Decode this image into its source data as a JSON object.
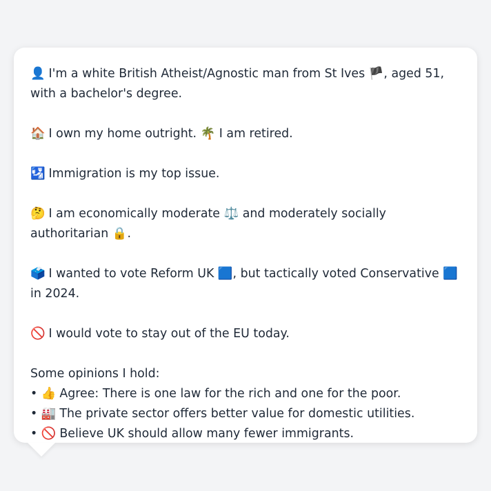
{
  "profile": {
    "identity": {
      "icon": "👤",
      "text_before_flag": " I'm a white British Atheist/Agnostic man from St Ives ",
      "flag": "🏴",
      "text_after_flag": ", aged 51, with a bachelor's degree."
    },
    "home": {
      "icon": "🏠",
      "text1": " I own my home outright. ",
      "icon2": "🌴",
      "text2": " I am retired."
    },
    "issue": {
      "icon": "🛂",
      "text": " Immigration is my top issue."
    },
    "ideology": {
      "icon": "🤔",
      "text1": " I am economically moderate ",
      "icon2": "⚖️",
      "text2": " and moderately socially authoritarian ",
      "icon3": "🔒",
      "text3": "."
    },
    "vote": {
      "icon": "🗳️",
      "text1": " I wanted to vote Reform UK ",
      "icon2": "🟦",
      "text2": ", but tactically voted Conservative ",
      "icon3": "🟦",
      "text3": " in 2024."
    },
    "eu": {
      "icon": "🚫",
      "text": " I would vote to stay out of the EU today."
    },
    "opinions": {
      "heading": "Some opinions I hold:",
      "items": [
        {
          "bullet": "•",
          "icon": "👍",
          "text": " Agree: There is one law for the rich and one for the poor."
        },
        {
          "bullet": "•",
          "icon": "🏭",
          "text": " The private sector offers better value for domestic utilities."
        },
        {
          "bullet": "•",
          "icon": "🚫",
          "text": " Believe UK should allow many fewer immigrants."
        }
      ]
    }
  }
}
